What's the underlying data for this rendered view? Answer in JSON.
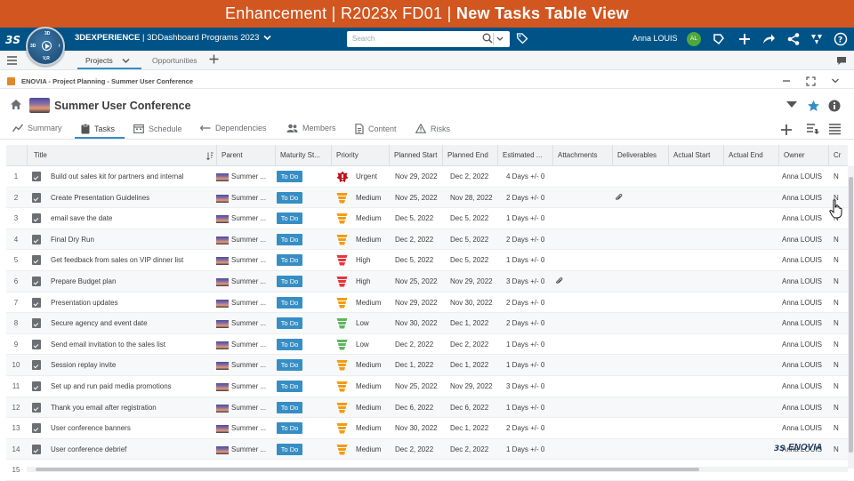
{
  "banner": {
    "prefix": "Enhancement | R2023x FD01 | ",
    "bold": "New Tasks Table View"
  },
  "topbar": {
    "brand": "3DEXPERIENCE",
    "app": " | 3DDashboard  ",
    "dashboard": "Programs 2023",
    "search_placeholder": "Search",
    "user_name": "Anna LOUIS",
    "user_initials": "AL"
  },
  "compass": {
    "north": "3D",
    "west": "3D",
    "east": "i",
    "south": "V,R"
  },
  "tabs": [
    {
      "label": "Projects"
    },
    {
      "label": "Opportunities"
    }
  ],
  "breadcrumb": "ENOVIA - Project Planning - Summer User Conference",
  "object": {
    "title": "Summer User Conference"
  },
  "subtabs": [
    {
      "label": "Summary"
    },
    {
      "label": "Tasks"
    },
    {
      "label": "Schedule"
    },
    {
      "label": "Dependencies"
    },
    {
      "label": "Members"
    },
    {
      "label": "Content"
    },
    {
      "label": "Risks"
    }
  ],
  "table": {
    "headers": [
      "Title",
      "Parent",
      "Maturity St...",
      "Priority",
      "Planned Start",
      "Planned End",
      "Estimated ...",
      "Attachments",
      "Deliverables",
      "Actual Start",
      "Actual End",
      "Owner",
      "Cr"
    ],
    "rows": [
      {
        "n": "1",
        "title": "Build out sales kit for partners and internal",
        "parent": "Summer ...",
        "state": "To Do",
        "priority": "Urgent",
        "start": "Nov 29, 2022",
        "end": "Dec 2, 2022",
        "est": "4 Days +/- 0",
        "attach": "",
        "owner": "Anna LOUIS",
        "cr": "N"
      },
      {
        "n": "2",
        "title": "Create Presentation Guidelines",
        "parent": "Summer ...",
        "state": "To Do",
        "priority": "Medium",
        "start": "Nov 25, 2022",
        "end": "Nov 28, 2022",
        "est": "2 Days +/- 0",
        "attach": "deliv",
        "owner": "Anna LOUIS",
        "cr": "N"
      },
      {
        "n": "3",
        "title": "email save the date",
        "parent": "Summer ...",
        "state": "To Do",
        "priority": "Medium",
        "start": "Dec 5, 2022",
        "end": "Dec 5, 2022",
        "est": "1 Days +/- 0",
        "attach": "",
        "owner": "Anna LOUIS",
        "cr": "N"
      },
      {
        "n": "4",
        "title": "Final Dry Run",
        "parent": "Summer ...",
        "state": "To Do",
        "priority": "Medium",
        "start": "Dec 2, 2022",
        "end": "Dec 5, 2022",
        "est": "2 Days +/- 0",
        "attach": "",
        "owner": "Anna LOUIS",
        "cr": "N"
      },
      {
        "n": "5",
        "title": "Get feedback from sales on VIP dinner list",
        "parent": "Summer ...",
        "state": "To Do",
        "priority": "High",
        "start": "Dec 5, 2022",
        "end": "Dec 5, 2022",
        "est": "1 Days +/- 0",
        "attach": "",
        "owner": "Anna LOUIS",
        "cr": "N"
      },
      {
        "n": "6",
        "title": "Prepare Budget plan",
        "parent": "Summer ...",
        "state": "To Do",
        "priority": "High",
        "start": "Nov 25, 2022",
        "end": "Nov 29, 2022",
        "est": "3 Days +/- 0",
        "attach": "attach",
        "owner": "Anna LOUIS",
        "cr": "N"
      },
      {
        "n": "7",
        "title": "Presentation updates",
        "parent": "Summer ...",
        "state": "To Do",
        "priority": "Medium",
        "start": "Nov 29, 2022",
        "end": "Nov 30, 2022",
        "est": "2 Days +/- 0",
        "attach": "",
        "owner": "Anna LOUIS",
        "cr": "N"
      },
      {
        "n": "8",
        "title": "Secure agency and event date",
        "parent": "Summer ...",
        "state": "To Do",
        "priority": "Low",
        "start": "Nov 30, 2022",
        "end": "Dec 1, 2022",
        "est": "2 Days +/- 0",
        "attach": "",
        "owner": "Anna LOUIS",
        "cr": "N"
      },
      {
        "n": "9",
        "title": "Send email invitation to the sales list",
        "parent": "Summer ...",
        "state": "To Do",
        "priority": "Low",
        "start": "Dec 2, 2022",
        "end": "Dec 2, 2022",
        "est": "1 Days +/- 0",
        "attach": "",
        "owner": "Anna LOUIS",
        "cr": "N"
      },
      {
        "n": "10",
        "title": "Session replay invite",
        "parent": "Summer ...",
        "state": "To Do",
        "priority": "Medium",
        "start": "Dec 1, 2022",
        "end": "Dec 1, 2022",
        "est": "1 Days +/- 0",
        "attach": "",
        "owner": "Anna LOUIS",
        "cr": "N"
      },
      {
        "n": "11",
        "title": "Set up and run paid media promotions",
        "parent": "Summer ...",
        "state": "To Do",
        "priority": "Medium",
        "start": "Nov 25, 2022",
        "end": "Nov 29, 2022",
        "est": "3 Days +/- 0",
        "attach": "",
        "owner": "Anna LOUIS",
        "cr": "N"
      },
      {
        "n": "12",
        "title": "Thank you email after registration",
        "parent": "Summer ...",
        "state": "To Do",
        "priority": "Medium",
        "start": "Dec 6, 2022",
        "end": "Dec 6, 2022",
        "est": "1 Days +/- 0",
        "attach": "",
        "owner": "Anna LOUIS",
        "cr": "N"
      },
      {
        "n": "13",
        "title": "User conference banners",
        "parent": "Summer ...",
        "state": "To Do",
        "priority": "Medium",
        "start": "Nov 30, 2022",
        "end": "Dec 1, 2022",
        "est": "2 Days +/- 0",
        "attach": "",
        "owner": "Anna LOUIS",
        "cr": "N"
      },
      {
        "n": "14",
        "title": "User conference debrief",
        "parent": "Summer ...",
        "state": "To Do",
        "priority": "Medium",
        "start": "Dec 2, 2022",
        "end": "Dec 2, 2022",
        "est": "1 Days +/- 0",
        "attach": "",
        "owner": "Anna LOUIS",
        "cr": "N"
      },
      {
        "n": "15",
        "title": "",
        "parent": "",
        "state": "",
        "priority": "",
        "start": "",
        "end": "",
        "est": "",
        "attach": "",
        "owner": "",
        "cr": ""
      }
    ]
  },
  "priority_colors": {
    "Urgent": "#c0121b",
    "High": "#e8343c",
    "Medium": "#f39c12",
    "Low": "#5cb85c"
  },
  "colors": {
    "banner": "#d1561f",
    "topbar": "#005386",
    "accent": "#368ec4"
  },
  "brand_footer": "ENOVIA"
}
